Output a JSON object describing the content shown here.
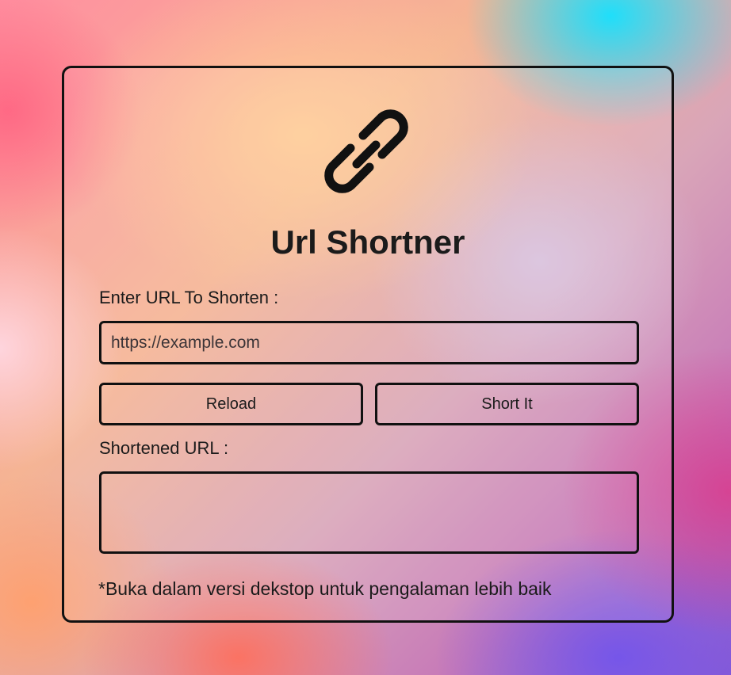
{
  "app": {
    "title": "Url Shortner",
    "logo_icon": "link-icon"
  },
  "form": {
    "url_label": "Enter URL To Shorten :",
    "url_placeholder": "https://example.com",
    "url_value": "",
    "reload_label": "Reload",
    "short_label": "Short It",
    "result_label": "Shortened URL :",
    "result_value": ""
  },
  "footer": {
    "note": "*Buka dalam versi dekstop untuk pengalaman lebih baik"
  },
  "colors": {
    "border": "#111111",
    "text": "#1b1b1b"
  }
}
